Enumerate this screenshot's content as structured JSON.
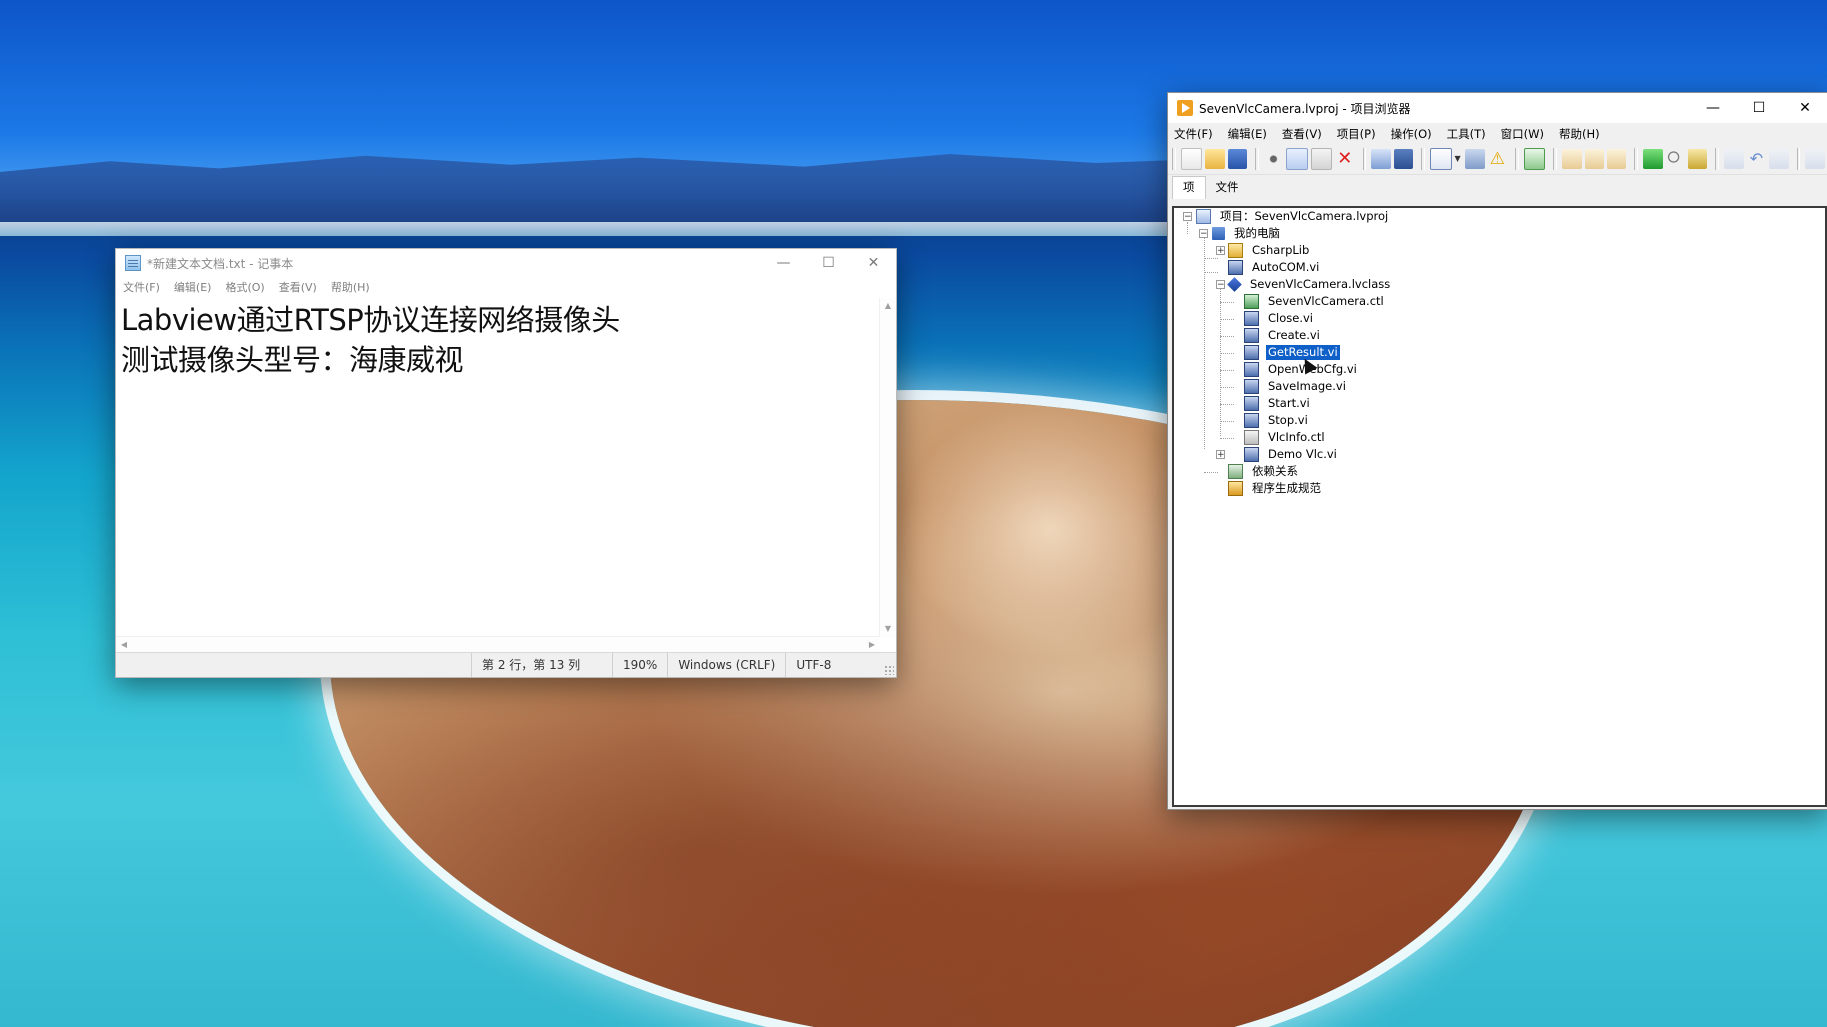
{
  "notepad": {
    "title": "*新建文本文档.txt - 记事本",
    "menu": [
      "文件(F)",
      "编辑(E)",
      "格式(O)",
      "查看(V)",
      "帮助(H)"
    ],
    "lines": [
      "Labview通过RTSP协议连接网络摄像头",
      "测试摄像头型号：海康威视"
    ],
    "status": {
      "position": "第 2 行，第 13 列",
      "zoom": "190%",
      "line_ending": "Windows (CRLF)",
      "encoding": "UTF-8"
    },
    "controls": {
      "minimize": "—",
      "maximize": "☐",
      "close": "✕"
    }
  },
  "labview": {
    "title": "SevenVlcCamera.lvproj - 项目浏览器",
    "menu": [
      "文件(F)",
      "编辑(E)",
      "查看(V)",
      "项目(P)",
      "操作(O)",
      "工具(T)",
      "窗口(W)",
      "帮助(H)"
    ],
    "tabs": [
      "项",
      "文件"
    ],
    "controls": {
      "minimize": "—",
      "maximize": "☐",
      "close": "✕"
    },
    "tree": {
      "project": "项目：SevenVlcCamera.lvproj",
      "my_computer": "我的电脑",
      "csharplib": "CsharpLib",
      "autocom": "AutoCOM.vi",
      "class": "SevenVlcCamera.lvclass",
      "class_items": [
        "SevenVlcCamera.ctl",
        "Close.vi",
        "Create.vi",
        "GetResult.vi",
        "OpenWebCfg.vi",
        "SaveImage.vi",
        "Start.vi",
        "Stop.vi",
        "VlcInfo.ctl",
        "Demo Vlc.vi"
      ],
      "selected": "GetResult.vi",
      "dependencies": "依赖关系",
      "build_specs": "程序生成规范"
    },
    "icons": {
      "project": "project-icon",
      "computer": "computer-icon",
      "library": "library-icon",
      "vi": "vi-icon",
      "class": "class-icon",
      "control": "control-icon",
      "dependencies": "dependencies-icon",
      "build": "build-specs-icon"
    },
    "selection_color": "#0f5fc9"
  }
}
